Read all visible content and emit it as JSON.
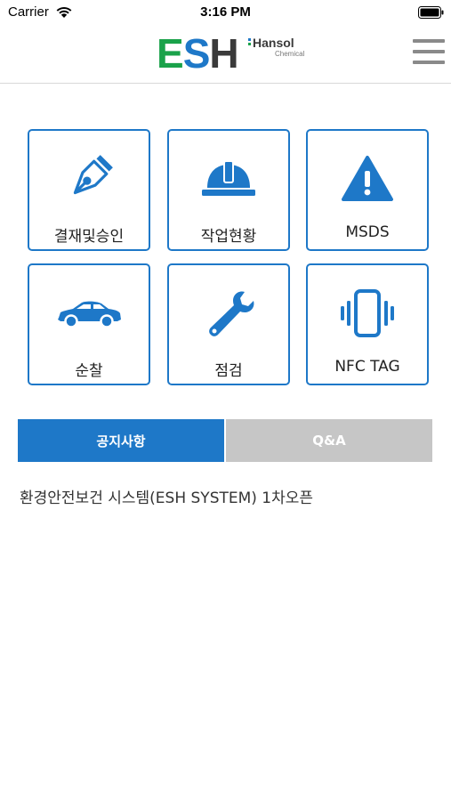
{
  "status_bar": {
    "carrier": "Carrier",
    "time": "3:16 PM"
  },
  "header": {
    "logo": {
      "brand": "ESH",
      "company": "Hansol",
      "company_sub": "Chemical",
      "brand_green": "#1aa24a",
      "brand_blue": "#1e78c8",
      "brand_dark": "#3a3a3a"
    },
    "menu_icon": "hamburger-icon"
  },
  "menu_grid": [
    {
      "label": "결재및승인",
      "icon": "fountain-pen-icon"
    },
    {
      "label": "작업현황",
      "icon": "hard-hat-icon"
    },
    {
      "label": "MSDS",
      "icon": "warning-triangle-icon"
    },
    {
      "label": "순찰",
      "icon": "car-icon"
    },
    {
      "label": "점검",
      "icon": "wrench-icon"
    },
    {
      "label": "NFC TAG",
      "icon": "phone-vibrate-icon"
    }
  ],
  "tabs": [
    {
      "label": "공지사항",
      "active": true
    },
    {
      "label": "Q&A",
      "active": false
    }
  ],
  "notices": [
    {
      "title": "환경안전보건 시스템(ESH SYSTEM) 1차오픈"
    }
  ],
  "colors": {
    "accent": "#1e78c8",
    "inactive_tab": "#c6c6c6"
  }
}
